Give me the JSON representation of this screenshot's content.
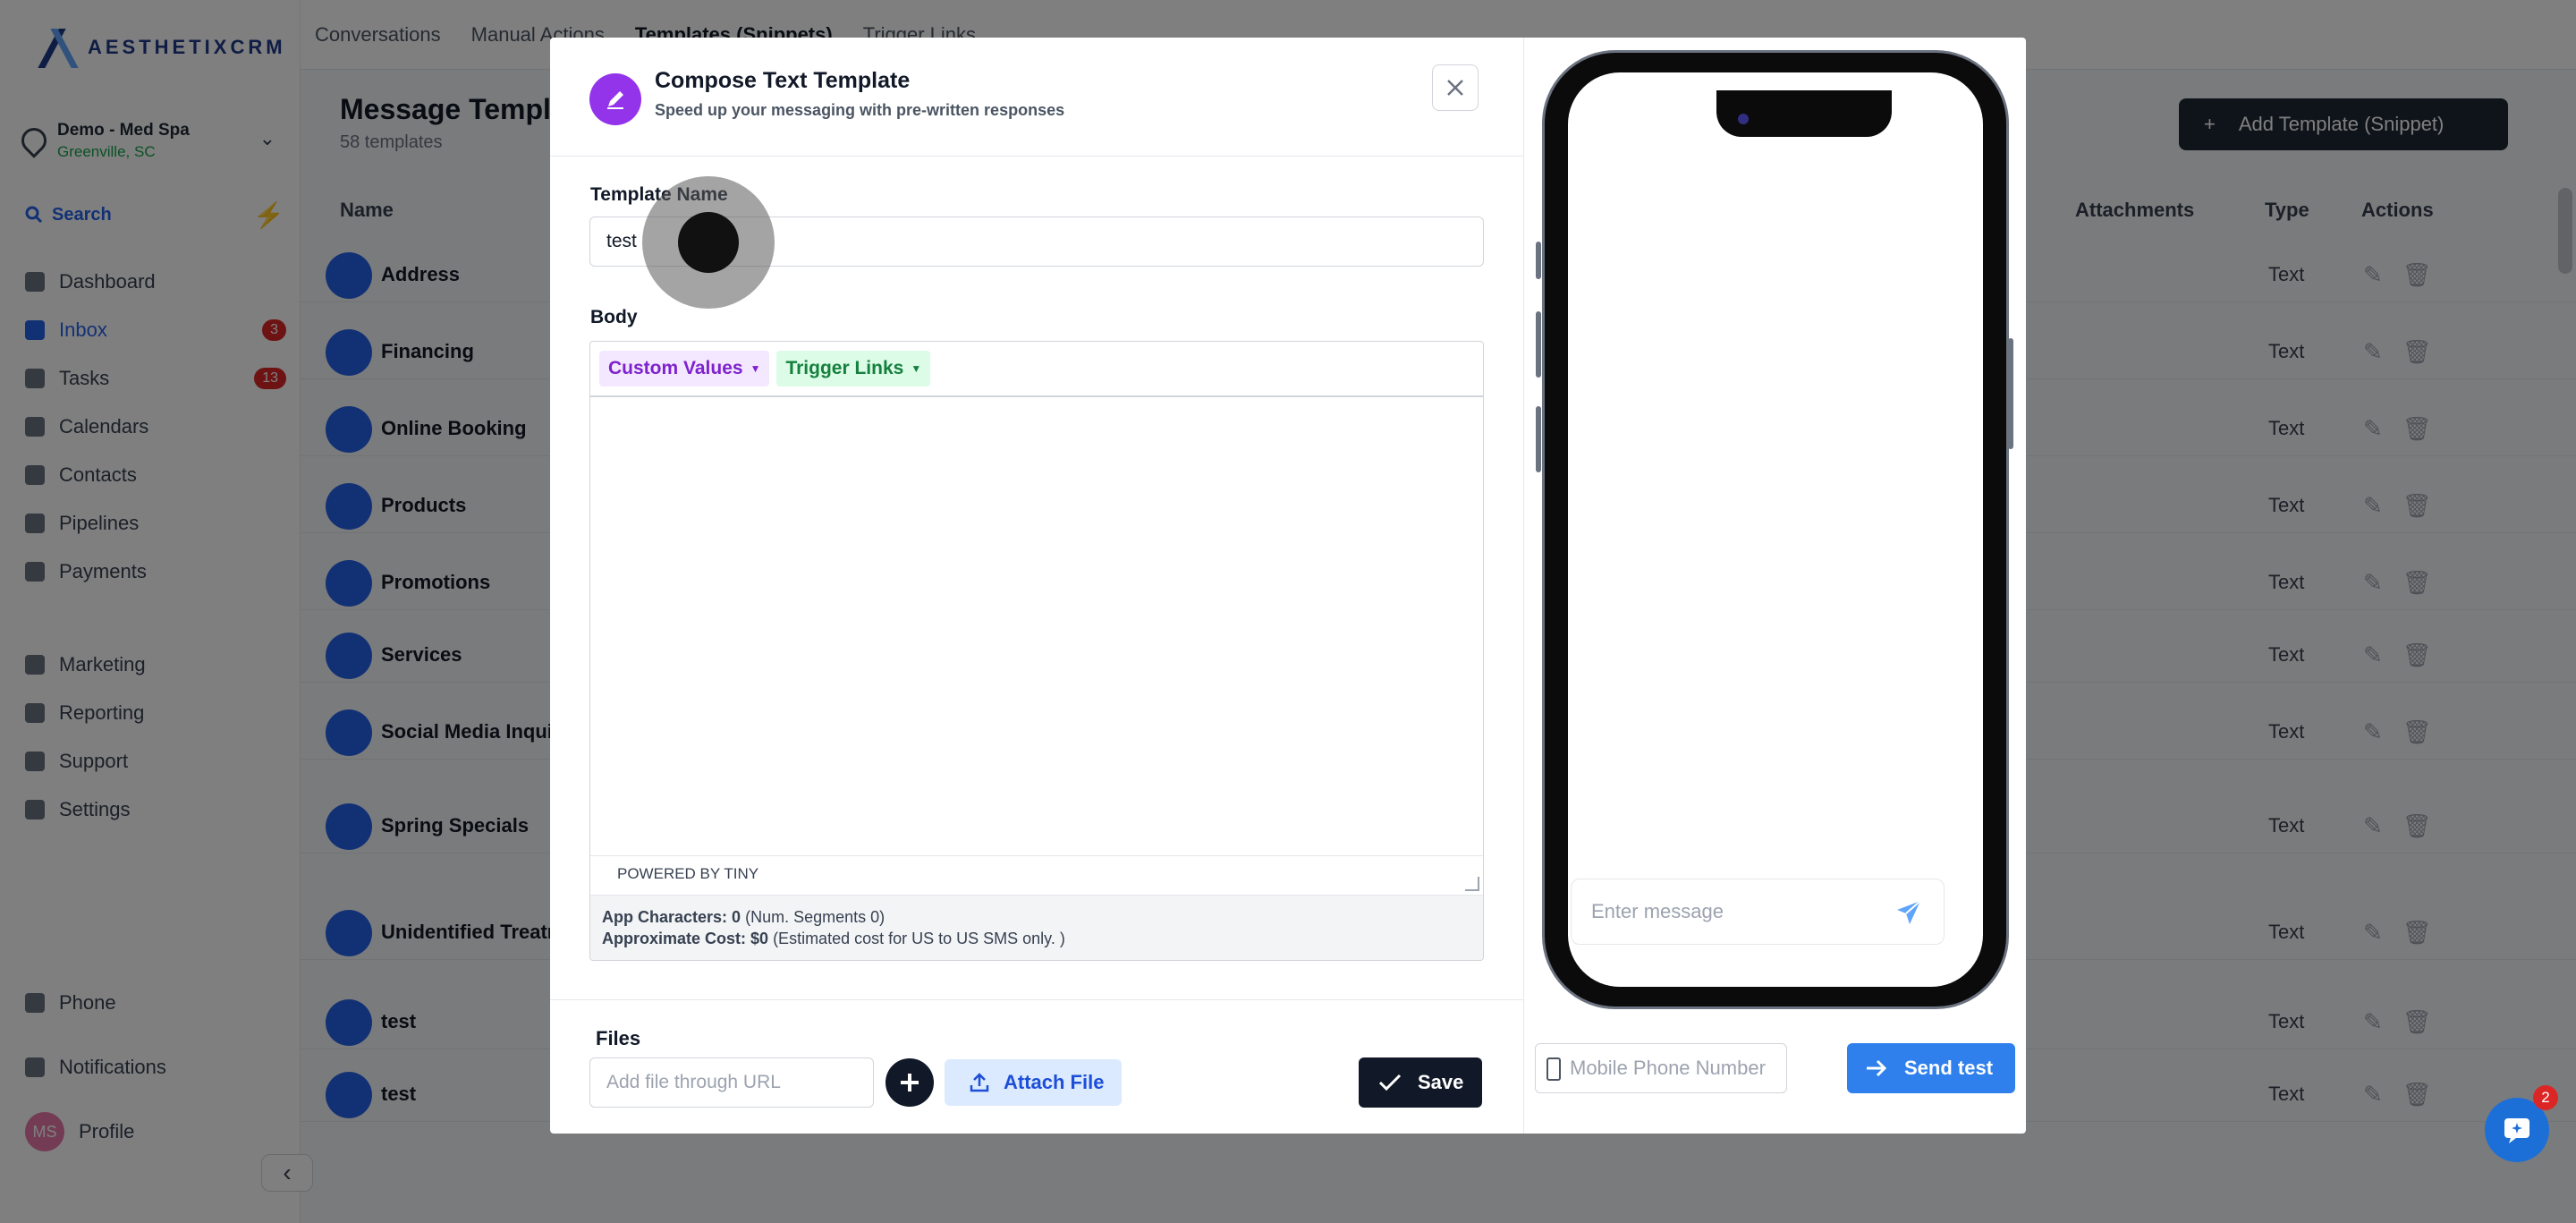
{
  "app": {
    "logo_text": "AESTHETIXCRM"
  },
  "location": {
    "name": "Demo - Med Spa",
    "city": "Greenville, SC"
  },
  "sidebar": {
    "search_label": "Search",
    "items": [
      {
        "label": "Dashboard",
        "badge": ""
      },
      {
        "label": "Inbox",
        "badge": "3"
      },
      {
        "label": "Tasks",
        "badge": "13"
      },
      {
        "label": "Calendars",
        "badge": ""
      },
      {
        "label": "Contacts",
        "badge": ""
      },
      {
        "label": "Pipelines",
        "badge": ""
      },
      {
        "label": "Payments",
        "badge": ""
      }
    ],
    "items2": [
      {
        "label": "Marketing"
      },
      {
        "label": "Reporting"
      },
      {
        "label": "Support"
      },
      {
        "label": "Settings"
      }
    ],
    "bottom": {
      "phone": "Phone",
      "notifications": "Notifications",
      "profile": "Profile",
      "avatar_initials": "MS"
    }
  },
  "topnav": {
    "tabs": [
      "Conversations",
      "Manual Actions",
      "Templates (Snippets)",
      "Trigger Links"
    ]
  },
  "page": {
    "title": "Message Templates",
    "subtitle": "58 templates",
    "add_button": "Add Template (Snippet)",
    "columns": {
      "name": "Name",
      "attachments": "Attachments",
      "type": "Type",
      "actions": "Actions"
    },
    "rows": [
      {
        "name": "Address",
        "type": "Text"
      },
      {
        "name": "Financing",
        "type": "Text"
      },
      {
        "name": "Online Booking",
        "type": "Text"
      },
      {
        "name": "Products",
        "type": "Text"
      },
      {
        "name": "Promotions",
        "type": "Text"
      },
      {
        "name": "Services",
        "type": "Text"
      },
      {
        "name": "Social Media Inquiries",
        "type": "Text"
      },
      {
        "name": "Spring Specials",
        "type": "Text"
      },
      {
        "name": "Unidentified Treatment",
        "type": "Text"
      },
      {
        "name": "test",
        "type": "Text"
      },
      {
        "name": "test",
        "type": "Text"
      }
    ]
  },
  "modal": {
    "title": "Compose Text Template",
    "subtitle": "Speed up your messaging with pre-written responses",
    "template_name_label": "Template Name",
    "template_name_value": "test",
    "body_label": "Body",
    "toolbar": {
      "custom_values": "Custom Values",
      "trigger_links": "Trigger Links"
    },
    "powered_by": "POWERED BY TINY",
    "stats": {
      "chars_label": "App Characters: 0",
      "chars_note": "(Num. Segments 0)",
      "cost_label": "Approximate Cost: $0",
      "cost_note": "(Estimated cost for US to US SMS only. )"
    },
    "files_label": "Files",
    "url_placeholder": "Add file through URL",
    "attach_label": "Attach File",
    "save_label": "Save"
  },
  "preview": {
    "message_placeholder": "Enter message",
    "mobile_placeholder": "Mobile Phone Number",
    "send_test_label": "Send test"
  },
  "chat_widget": {
    "badge": "2"
  },
  "colors": {
    "accent": "#2f80ed",
    "purple": "#9333ea",
    "dark": "#111827"
  }
}
